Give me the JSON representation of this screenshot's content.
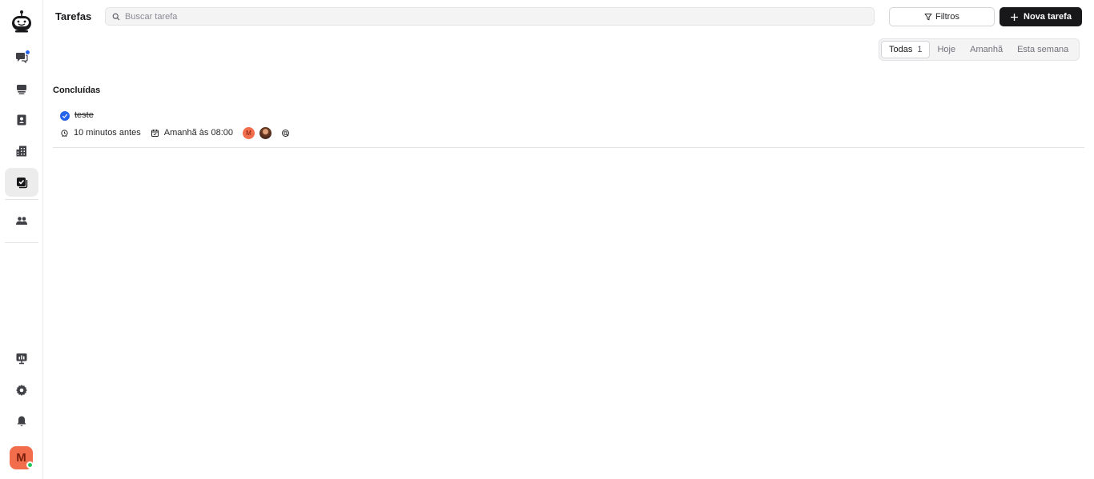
{
  "page": {
    "title": "Tarefas"
  },
  "search": {
    "placeholder": "Buscar tarefa",
    "value": ""
  },
  "toolbar": {
    "filter_label": "Filtros",
    "new_task_label": "Nova tarefa"
  },
  "tabs": [
    {
      "label": "Todas",
      "count": "1",
      "active": true
    },
    {
      "label": "Hoje"
    },
    {
      "label": "Amanhã"
    },
    {
      "label": "Esta semana"
    }
  ],
  "section": {
    "title": "Concluídas"
  },
  "task": {
    "title": "teste",
    "completed": true,
    "created": "10 minutos antes",
    "due": "Amanhã às 08:00",
    "assignee_initial": "M"
  },
  "user": {
    "initial": "M",
    "status": "online"
  },
  "sidebar": {
    "items": [
      {
        "icon": "chat-icon",
        "badge": true
      },
      {
        "icon": "inbox-icon"
      },
      {
        "icon": "contacts-icon"
      },
      {
        "icon": "companies-icon"
      },
      {
        "icon": "tasks-icon",
        "active": true
      },
      {
        "icon": "team-icon"
      },
      {
        "icon": "reports-icon"
      },
      {
        "icon": "settings-icon"
      },
      {
        "icon": "notifications-icon"
      }
    ]
  },
  "colors": {
    "accent": "#2563eb",
    "primary_button": "#18181b",
    "avatar": "#f26d4b",
    "online": "#22c55e"
  }
}
